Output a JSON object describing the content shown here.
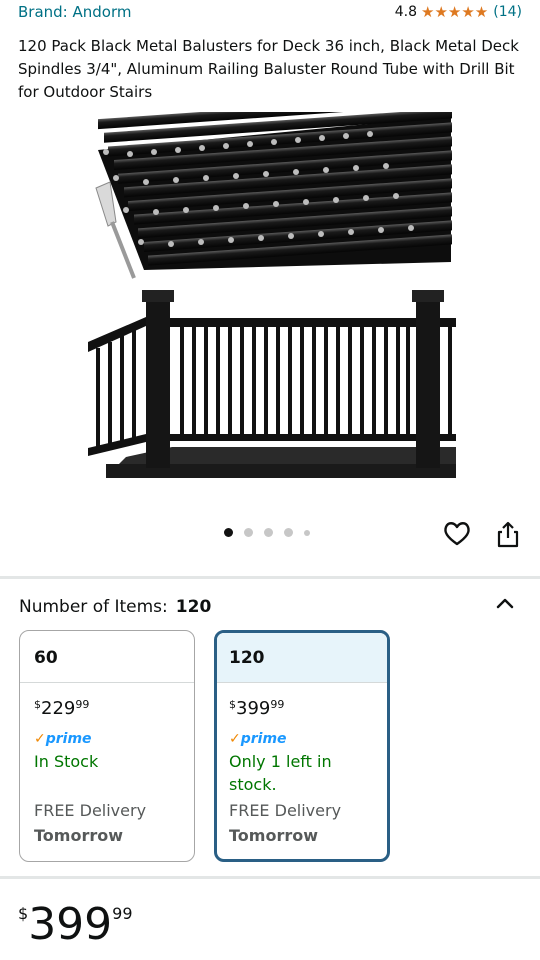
{
  "product": {
    "brand": "Brand: Andorm",
    "rating": "4.8",
    "stars": "★★★★★",
    "review_count": "(14)",
    "title": "120 Pack Black Metal Balusters for Deck 36 inch, Black Metal Deck Spindles 3/4\", Aluminum Railing Baluster Round Tube with Drill Bit for Outdoor Stairs",
    "image_count": 5,
    "active_image_index": 0
  },
  "icons": {
    "wishlist": "heart-icon",
    "share": "share-icon",
    "collapse": "chevron-up-icon"
  },
  "variation": {
    "label": "Number of Items:",
    "selected": "120",
    "options": [
      {
        "name": "60",
        "price_symbol": "$",
        "price_whole": "229",
        "price_fraction": "99",
        "prime_check": "✓",
        "prime_text": "prime",
        "stock": "In Stock",
        "delivery": "FREE Delivery",
        "delivery_day": "Tomorrow",
        "selected": false
      },
      {
        "name": "120",
        "price_symbol": "$",
        "price_whole": "399",
        "price_fraction": "99",
        "prime_check": "✓",
        "prime_text": "prime",
        "stock": "Only 1 left in stock.",
        "delivery": "FREE Delivery",
        "delivery_day": "Tomorrow",
        "selected": true
      }
    ]
  },
  "buybox": {
    "price_symbol": "$",
    "price_whole": "399",
    "price_fraction": "99"
  },
  "colors": {
    "link": "#007185",
    "star": "#de7921",
    "in_stock": "#007600",
    "selected_border": "#2a5f85",
    "selected_bg": "#e7f4fa",
    "prime_blue": "#1a98ff",
    "prime_check": "#f08804"
  }
}
